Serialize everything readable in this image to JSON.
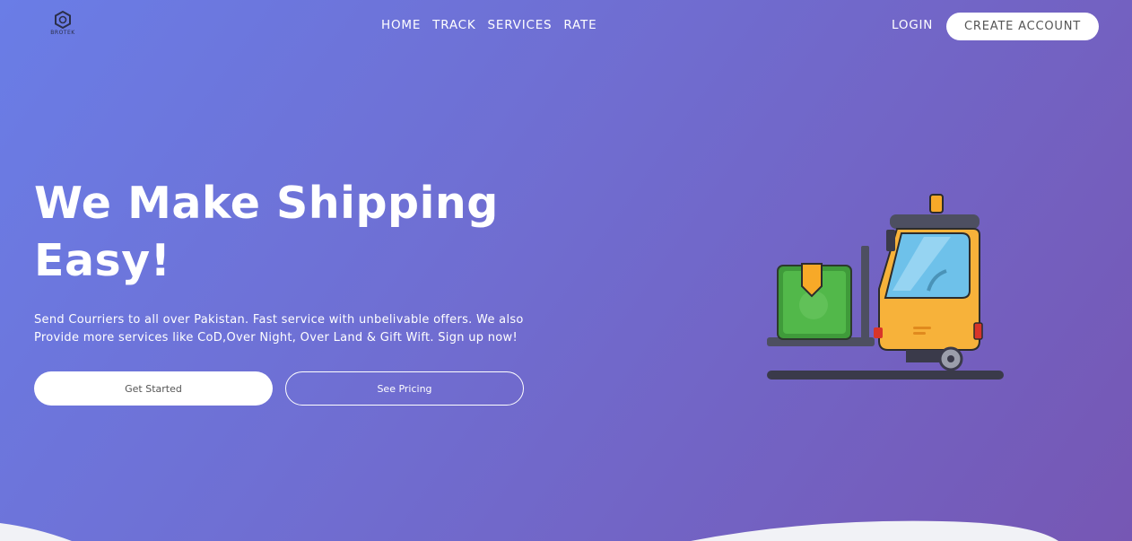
{
  "brand": {
    "logo_text": "BROTEK"
  },
  "nav": {
    "items": [
      "HOME",
      "TRACK",
      "SERVICES",
      "RATE"
    ]
  },
  "auth": {
    "login_label": "LOGIN",
    "create_account_label": "CREATE ACCOUNT"
  },
  "hero": {
    "title_line1": "We Make Shipping",
    "title_line2": "Easy!",
    "description": "Send Courriers to all over Pakistan. Fast service with unbelivable offers. We also Provide more services like CoD,Over Night, Over Land & Gift Wift. Sign up now!",
    "primary_button": "Get Started",
    "secondary_button": "See Pricing"
  },
  "illustration": {
    "icon": "forklift-with-package-icon"
  }
}
